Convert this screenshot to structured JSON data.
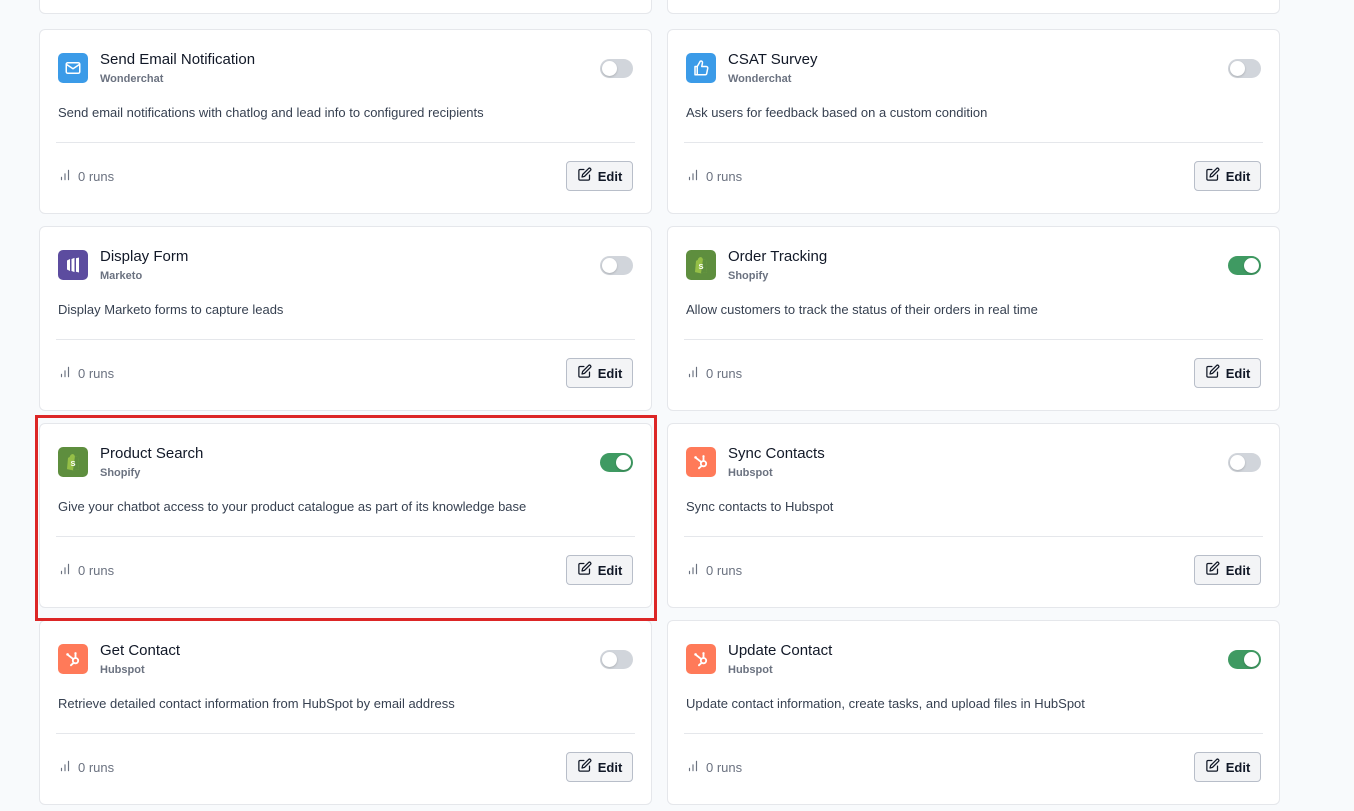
{
  "colors": {
    "toggle_on": "#3f9a62",
    "toggle_off": "#d1d5db",
    "highlight": "#dc2626",
    "wonderchat_icon": "#3b9be8",
    "marketo_icon": "#5c4c9f",
    "shopify_icon": "#5e8e3e",
    "hubspot_icon": "#ff7a59"
  },
  "cards": [
    {
      "title": "Send Email Notification",
      "vendor": "Wonderchat",
      "icon": "mail-icon",
      "enabled": false,
      "description": "Send email notifications with chatlog and lead info to configured recipients",
      "runs": "0 runs",
      "edit_label": "Edit"
    },
    {
      "title": "CSAT Survey",
      "vendor": "Wonderchat",
      "icon": "thumbs-up-icon",
      "enabled": false,
      "description": "Ask users for feedback based on a custom condition",
      "runs": "0 runs",
      "edit_label": "Edit"
    },
    {
      "title": "Display Form",
      "vendor": "Marketo",
      "icon": "marketo-logo-icon",
      "enabled": false,
      "description": "Display Marketo forms to capture leads",
      "runs": "0 runs",
      "edit_label": "Edit"
    },
    {
      "title": "Order Tracking",
      "vendor": "Shopify",
      "icon": "shopify-logo-icon",
      "enabled": true,
      "description": "Allow customers to track the status of their orders in real time",
      "runs": "0 runs",
      "edit_label": "Edit"
    },
    {
      "title": "Product Search",
      "vendor": "Shopify",
      "icon": "shopify-logo-icon",
      "enabled": true,
      "description": "Give your chatbot access to your product catalogue as part of its knowledge base",
      "runs": "0 runs",
      "edit_label": "Edit"
    },
    {
      "title": "Sync Contacts",
      "vendor": "Hubspot",
      "icon": "hubspot-logo-icon",
      "enabled": false,
      "description": "Sync contacts to Hubspot",
      "runs": "0 runs",
      "edit_label": "Edit"
    },
    {
      "title": "Get Contact",
      "vendor": "Hubspot",
      "icon": "hubspot-logo-icon",
      "enabled": false,
      "description": "Retrieve detailed contact information from HubSpot by email address",
      "runs": "0 runs",
      "edit_label": "Edit"
    },
    {
      "title": "Update Contact",
      "vendor": "Hubspot",
      "icon": "hubspot-logo-icon",
      "enabled": true,
      "description": "Update contact information, create tasks, and upload files in HubSpot",
      "runs": "0 runs",
      "edit_label": "Edit"
    }
  ]
}
